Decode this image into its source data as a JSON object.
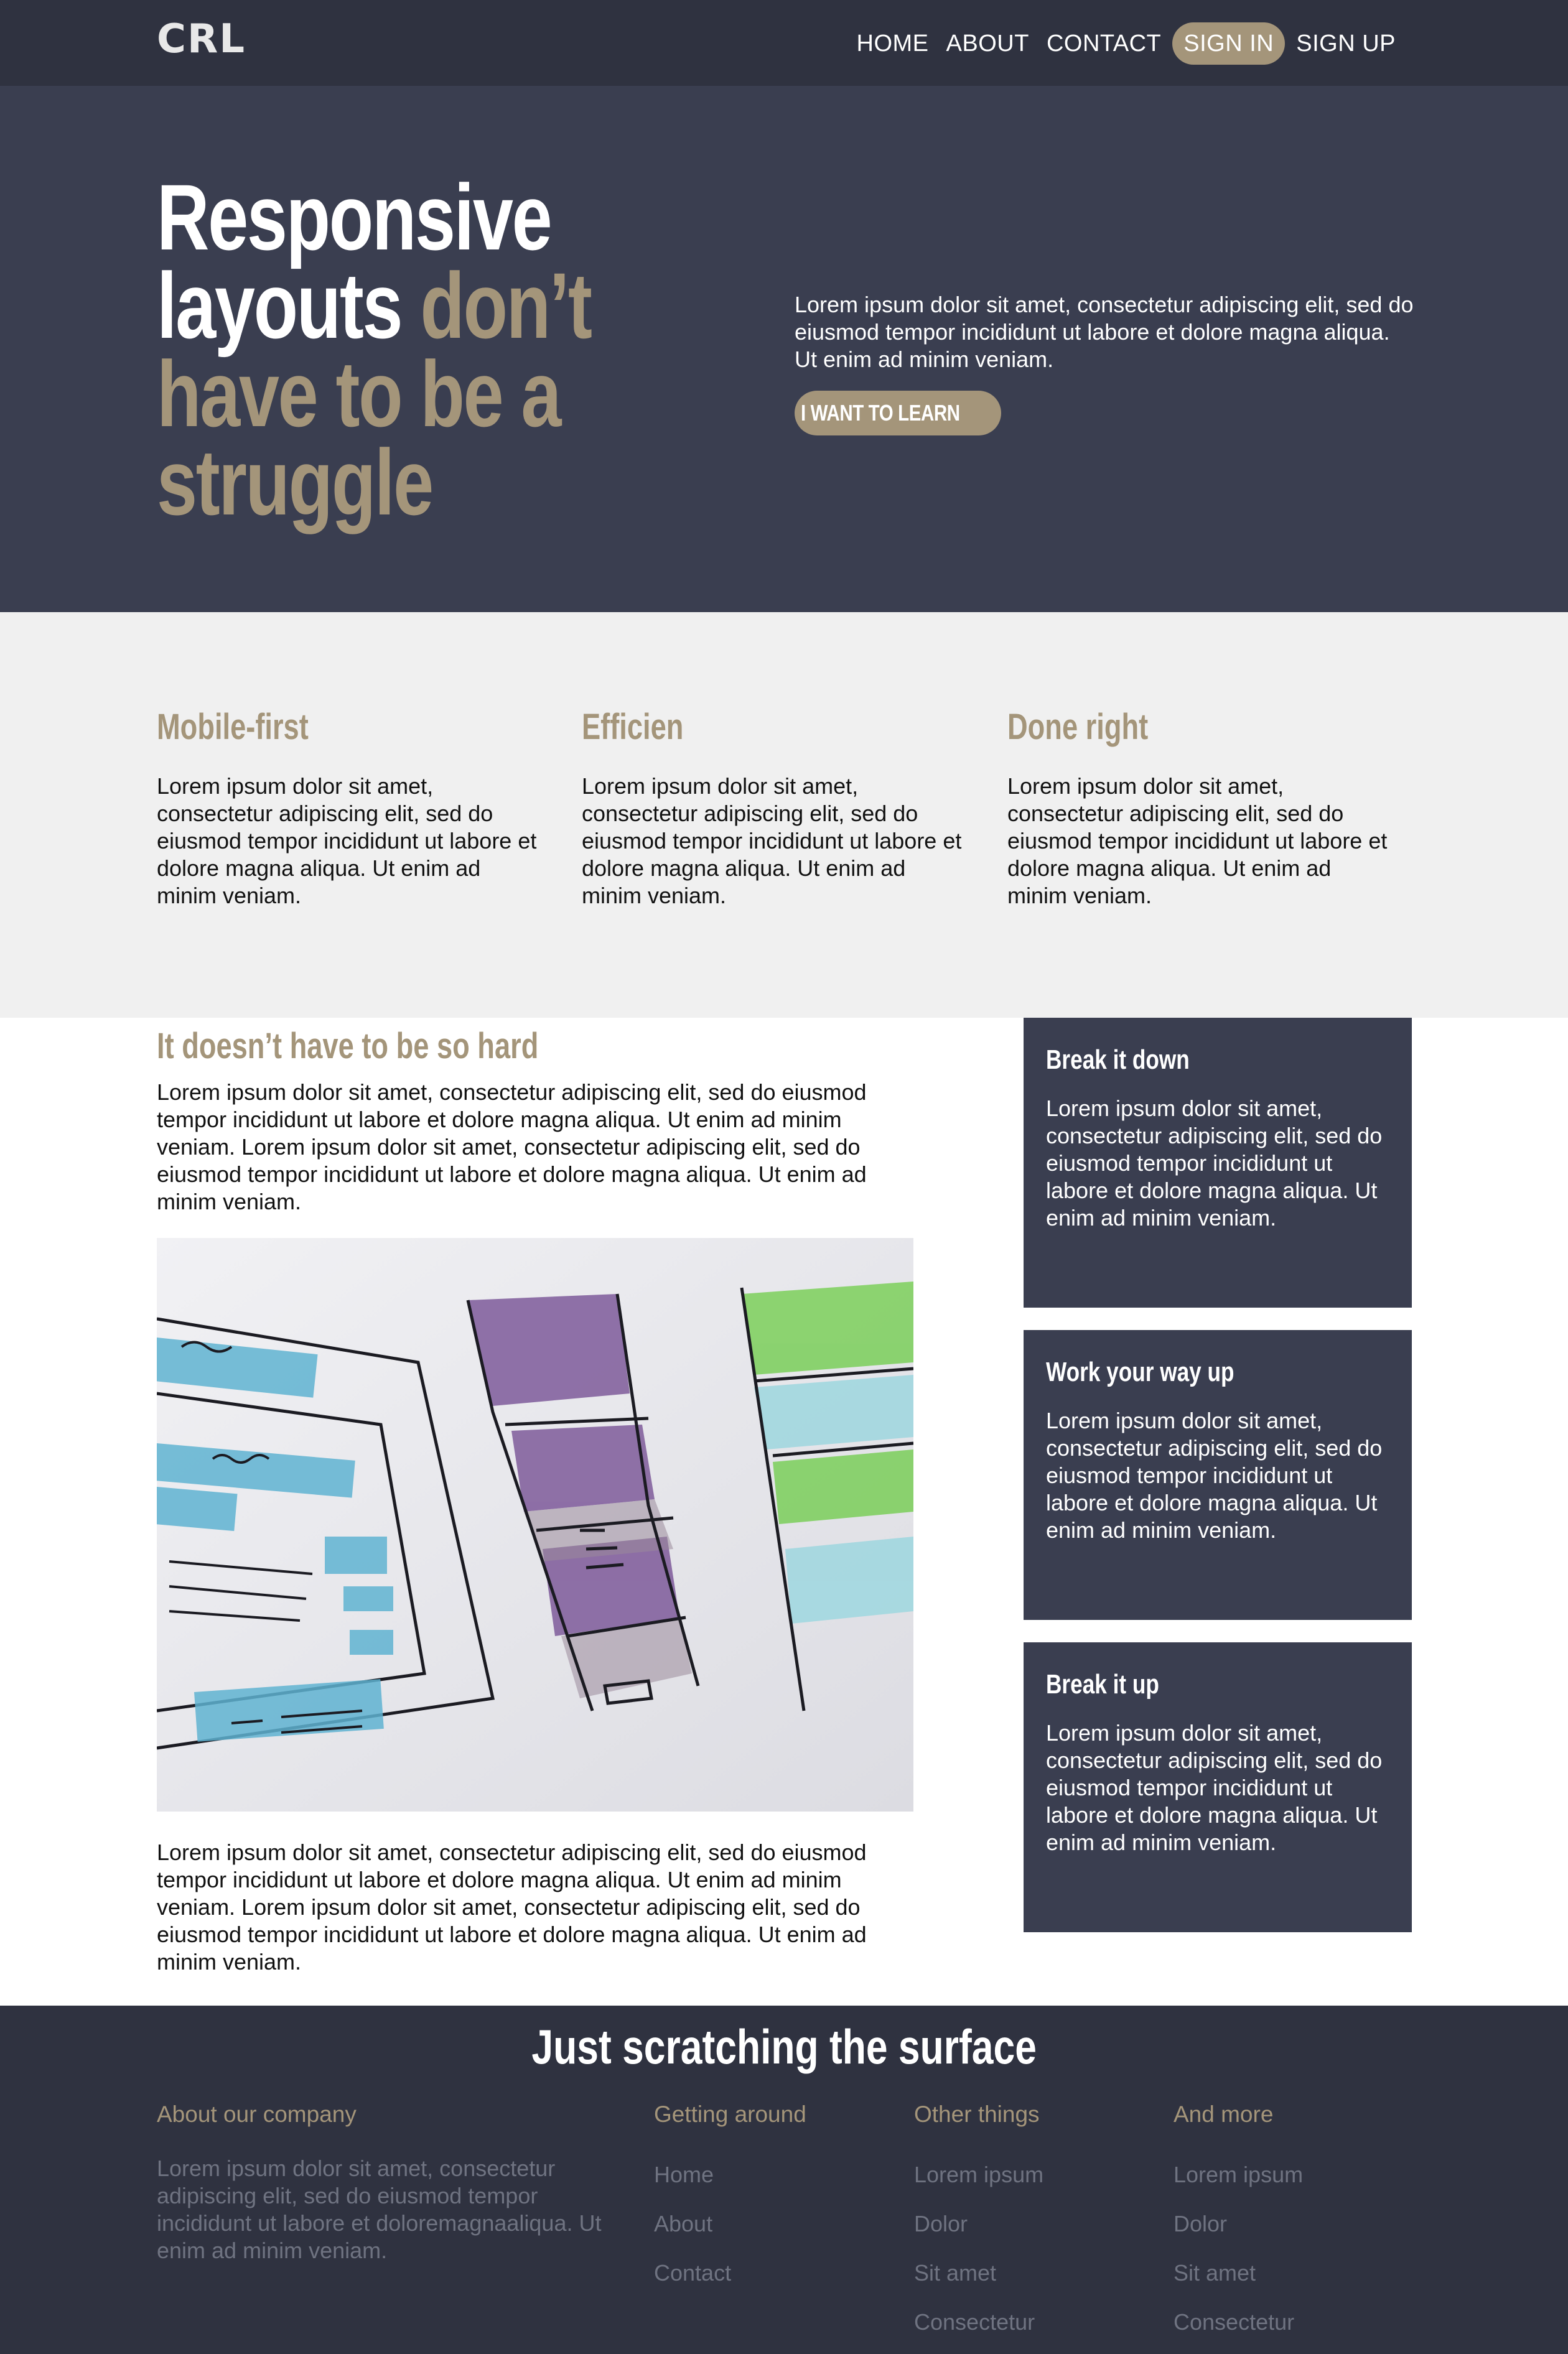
{
  "nav": {
    "logo": "CRL",
    "links": [
      {
        "label": "HOME"
      },
      {
        "label": "ABOUT"
      },
      {
        "label": "CONTACT"
      },
      {
        "label": "SIGN IN"
      },
      {
        "label": "SIGN UP"
      }
    ]
  },
  "hero": {
    "title_line1": "Responsive",
    "title_line2_white": "layouts",
    "title_line2_accent": "don’t",
    "title_line3": "have to be a",
    "title_line4": "struggle",
    "text": "Lorem ipsum dolor sit amet, consectetur adipiscing elit, sed do eiusmod tempor incididunt ut labore et dolore magna aliqua. Ut enim ad minim veniam.",
    "button": "I WANT TO LEARN"
  },
  "features": [
    {
      "title": "Mobile-first",
      "text": "Lorem ipsum dolor sit amet, consectetur adipiscing elit, sed do eiusmod tempor incididunt ut labore et dolore magna aliqua. Ut enim ad minim veniam."
    },
    {
      "title": "Efficien",
      "text": "Lorem ipsum dolor sit amet, consectetur adipiscing elit, sed do eiusmod tempor incididunt ut labore et dolore magna aliqua. Ut enim ad minim veniam."
    },
    {
      "title": "Done right",
      "text": "Lorem ipsum dolor sit amet, consectetur adipiscing elit, sed do eiusmod tempor incididunt ut labore et dolore magna aliqua. Ut enim ad minim veniam."
    }
  ],
  "main": {
    "title": "It doesn’t have to be so hard",
    "para1": "Lorem ipsum dolor sit amet, consectetur adipiscing elit, sed do eiusmod tempor incididunt ut labore et dolore magna aliqua. Ut enim ad minim veniam. Lorem ipsum dolor sit amet, consectetur adipiscing elit, sed do eiusmod tempor incididunt ut labore et dolore magna aliqua. Ut enim ad minim veniam.",
    "para2": "Lorem ipsum dolor sit amet, consectetur adipiscing elit, sed do eiusmod tempor incididunt ut labore et dolore magna aliqua. Ut enim ad minim veniam. Lorem ipsum dolor sit amet, consectetur adipiscing elit, sed do eiusmod tempor incididunt ut labore et dolore magna aliqua. Ut enim ad minim veniam."
  },
  "sidebar": [
    {
      "title": "Break it down",
      "text": "Lorem ipsum dolor sit amet, consectetur adipiscing elit, sed do eiusmod tempor incididunt ut labore et dolore magna aliqua. Ut enim ad minim veniam."
    },
    {
      "title": "Work your way up",
      "text": "Lorem ipsum dolor sit amet, consectetur adipiscing elit, sed do eiusmod tempor incididunt ut labore et dolore magna aliqua. Ut enim ad minim veniam."
    },
    {
      "title": "Break it up",
      "text": "Lorem ipsum dolor sit amet, consectetur adipiscing elit, sed do eiusmod tempor incididunt ut labore et dolore magna aliqua. Ut enim ad minim veniam."
    }
  ],
  "footer": {
    "title": "Just scratching the surface",
    "about_title": "About our company",
    "about_text": "Lorem ipsum dolor sit amet, consectetur adipiscing elit, sed do eiusmod tempor incididunt ut labore et doloremagnaaliqua. Ut enim ad minim veniam.",
    "col2_title": "Getting around",
    "col2_links": [
      "Home",
      "About",
      "Contact"
    ],
    "col3_title": "Other things",
    "col3_links": [
      "Lorem ipsum",
      "Dolor",
      "Sit amet",
      "Consectetur"
    ],
    "col4_title": "And more",
    "col4_links": [
      "Lorem ipsum",
      "Dolor",
      "Sit amet",
      "Consectetur"
    ]
  },
  "colors": {
    "nav_bg": "#2f3240",
    "hero_bg": "#3a3e50",
    "accent": "#a4957a",
    "features_bg": "#f0f0f0",
    "footer_text": "#6f7381"
  }
}
